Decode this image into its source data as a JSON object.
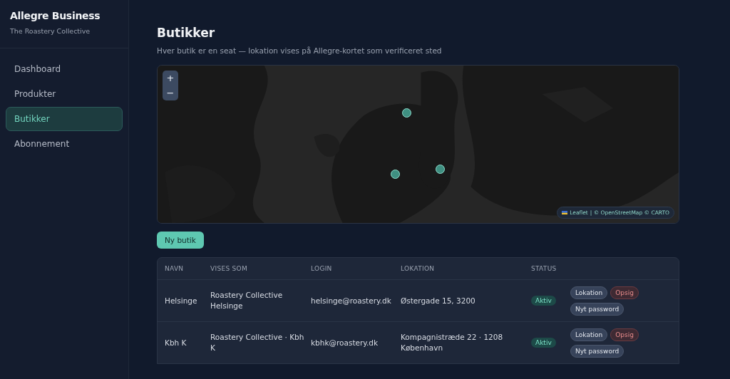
{
  "sidebar": {
    "brand": "Allegre Business",
    "org": "The Roastery Collective",
    "items": [
      {
        "label": "Dashboard",
        "selected": false
      },
      {
        "label": "Produkter",
        "selected": false
      },
      {
        "label": "Butikker",
        "selected": true
      },
      {
        "label": "Abonnement",
        "selected": false
      }
    ]
  },
  "page": {
    "title": "Butikker",
    "subtitle": "Hver butik er en seat — lokation vises på Allegre-kortet som verificeret sted"
  },
  "map": {
    "zoom_in": "+",
    "zoom_out": "−",
    "attribution": {
      "leaflet": "Leaflet",
      "rest": "| © OpenStreetMap © CARTO"
    }
  },
  "new_button": "Ny butik",
  "table": {
    "columns": [
      "NAVN",
      "VISES SOM",
      "LOGIN",
      "LOKATION",
      "STATUS"
    ],
    "rows": [
      {
        "name": "Helsinge",
        "display": "Roastery Collective Helsinge",
        "login": "helsinge@roastery.dk",
        "location": "Østergade 15, 3200",
        "status": "Aktiv",
        "actions": [
          {
            "label": "Lokation",
            "kind": "neutral"
          },
          {
            "label": "Opsig",
            "kind": "danger"
          },
          {
            "label": "Nyt password",
            "kind": "neutral"
          }
        ]
      },
      {
        "name": "Kbh K",
        "display": "Roastery Collective · Kbh K",
        "login": "kbhk@roastery.dk",
        "location": "Kompagnistræde 22 · 1208 København",
        "status": "Aktiv",
        "actions": [
          {
            "label": "Lokation",
            "kind": "neutral"
          },
          {
            "label": "Opsig",
            "kind": "danger"
          },
          {
            "label": "Nyt password",
            "kind": "neutral"
          }
        ]
      }
    ]
  }
}
